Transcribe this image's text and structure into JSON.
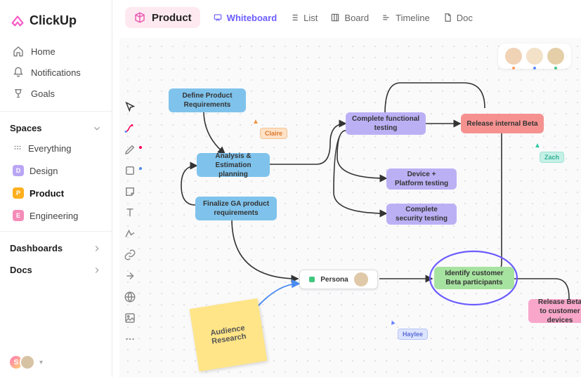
{
  "brand": "ClickUp",
  "nav": {
    "home": "Home",
    "notifications": "Notifications",
    "goals": "Goals"
  },
  "spacesHeader": "Spaces",
  "spaces": {
    "everything": "Everything",
    "design": {
      "badge": "D",
      "label": "Design",
      "color": "#b9a6f5"
    },
    "product": {
      "badge": "P",
      "label": "Product",
      "color": "#ffb01f"
    },
    "engineering": {
      "badge": "E",
      "label": "Engineering",
      "color": "#f58bb8"
    }
  },
  "dashboards": "Dashboards",
  "docs": "Docs",
  "header": {
    "space": "Product",
    "views": {
      "whiteboard": "Whiteboard",
      "list": "List",
      "board": "Board",
      "timeline": "Timeline",
      "doc": "Doc"
    }
  },
  "nodes": {
    "define": "Define Product Requirements",
    "analysis": "Analysis & Estimation planning",
    "finalize": "Finalize GA product requirements",
    "functional": "Complete functional testing",
    "device": "Device + Platform testing",
    "security": "Complete security testing",
    "release": "Release internal Beta",
    "identify": "Identify customer Beta participants",
    "releaseBeta": "Release Beta to customer devices",
    "persona": "Persona"
  },
  "sticky": "Audience Research",
  "cursors": {
    "claire": "Claire",
    "zach": "Zach",
    "haylee": "Haylee"
  },
  "bottomAvatar": "S",
  "colors": {
    "accent": "#6b5cff",
    "orange": "#ff9a57",
    "teal": "#2fc7a3"
  }
}
